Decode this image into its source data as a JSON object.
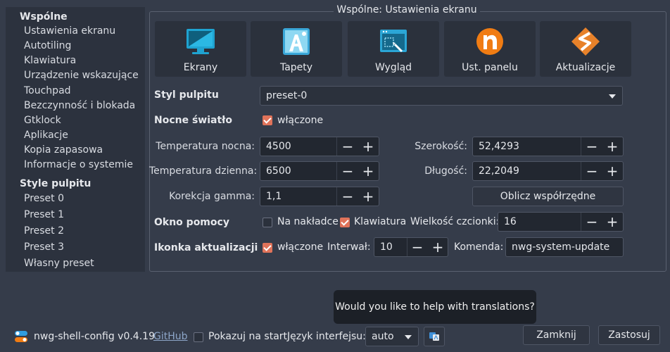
{
  "sidebar": {
    "section1": "Wspólne",
    "items1": [
      "Ustawienia ekranu",
      "Autotiling",
      "Klawiatura",
      "Urządzenie wskazujące",
      "Touchpad",
      "Bezczynność i blokada",
      "Gtklock",
      "Aplikacje",
      "Kopia zapasowa",
      "Informacje o systemie"
    ],
    "section2": "Style pulpitu",
    "items2": [
      "Preset 0",
      "Preset 1",
      "Preset 2",
      "Preset 3",
      "Własny preset"
    ]
  },
  "frame_title": "Wspólne: Ustawienia ekranu",
  "tiles": [
    {
      "label": "Ekrany",
      "icon": "display-icon"
    },
    {
      "label": "Tapety",
      "icon": "wallpaper-icon"
    },
    {
      "label": "Wygląd",
      "icon": "appearance-icon"
    },
    {
      "label": "Ust. panelu",
      "icon": "panel-icon"
    },
    {
      "label": "Aktualizacje",
      "icon": "update-icon"
    }
  ],
  "desktop_style": {
    "label": "Styl pulpitu",
    "value": "preset-0"
  },
  "night_light": {
    "label": "Nocne światło",
    "enabled_label": "włączone",
    "enabled": true,
    "night_temp_label": "Temperatura nocna:",
    "night_temp": "4500",
    "day_temp_label": "Temperatura dzienna:",
    "day_temp": "6500",
    "gamma_label": "Korekcja gamma:",
    "gamma": "1,1",
    "lat_label": "Szerokość:",
    "lat": "52,4293",
    "lon_label": "Długość:",
    "lon": "22,2049",
    "calc_button": "Oblicz współrzędne"
  },
  "help_window": {
    "label": "Okno pomocy",
    "overlay_label": "Na nakładce",
    "overlay": false,
    "keyboard_label": "Klawiatura",
    "keyboard": true,
    "font_size_label": "Wielkość czcionki:",
    "font_size": "16"
  },
  "update_icon": {
    "label": "Ikonka aktualizacji",
    "enabled_label": "włączone",
    "enabled": true,
    "interval_label": "Interwał:",
    "interval": "10",
    "command_label": "Komenda:",
    "command": "nwg-system-update"
  },
  "tooltip": "Would you like to help with translations?",
  "footer": {
    "app_name": "nwg-shell-config v0.4.19",
    "github": "GitHub",
    "show_on_start": "Pokazuj na start",
    "show_on_start_checked": false,
    "language_label": "Język interfejsu:",
    "language": "auto",
    "close": "Zamknij",
    "apply": "Zastosuj"
  },
  "colors": {
    "accent": "#e0735a",
    "background": "#353c4a",
    "sidebar": "#2c323e"
  }
}
